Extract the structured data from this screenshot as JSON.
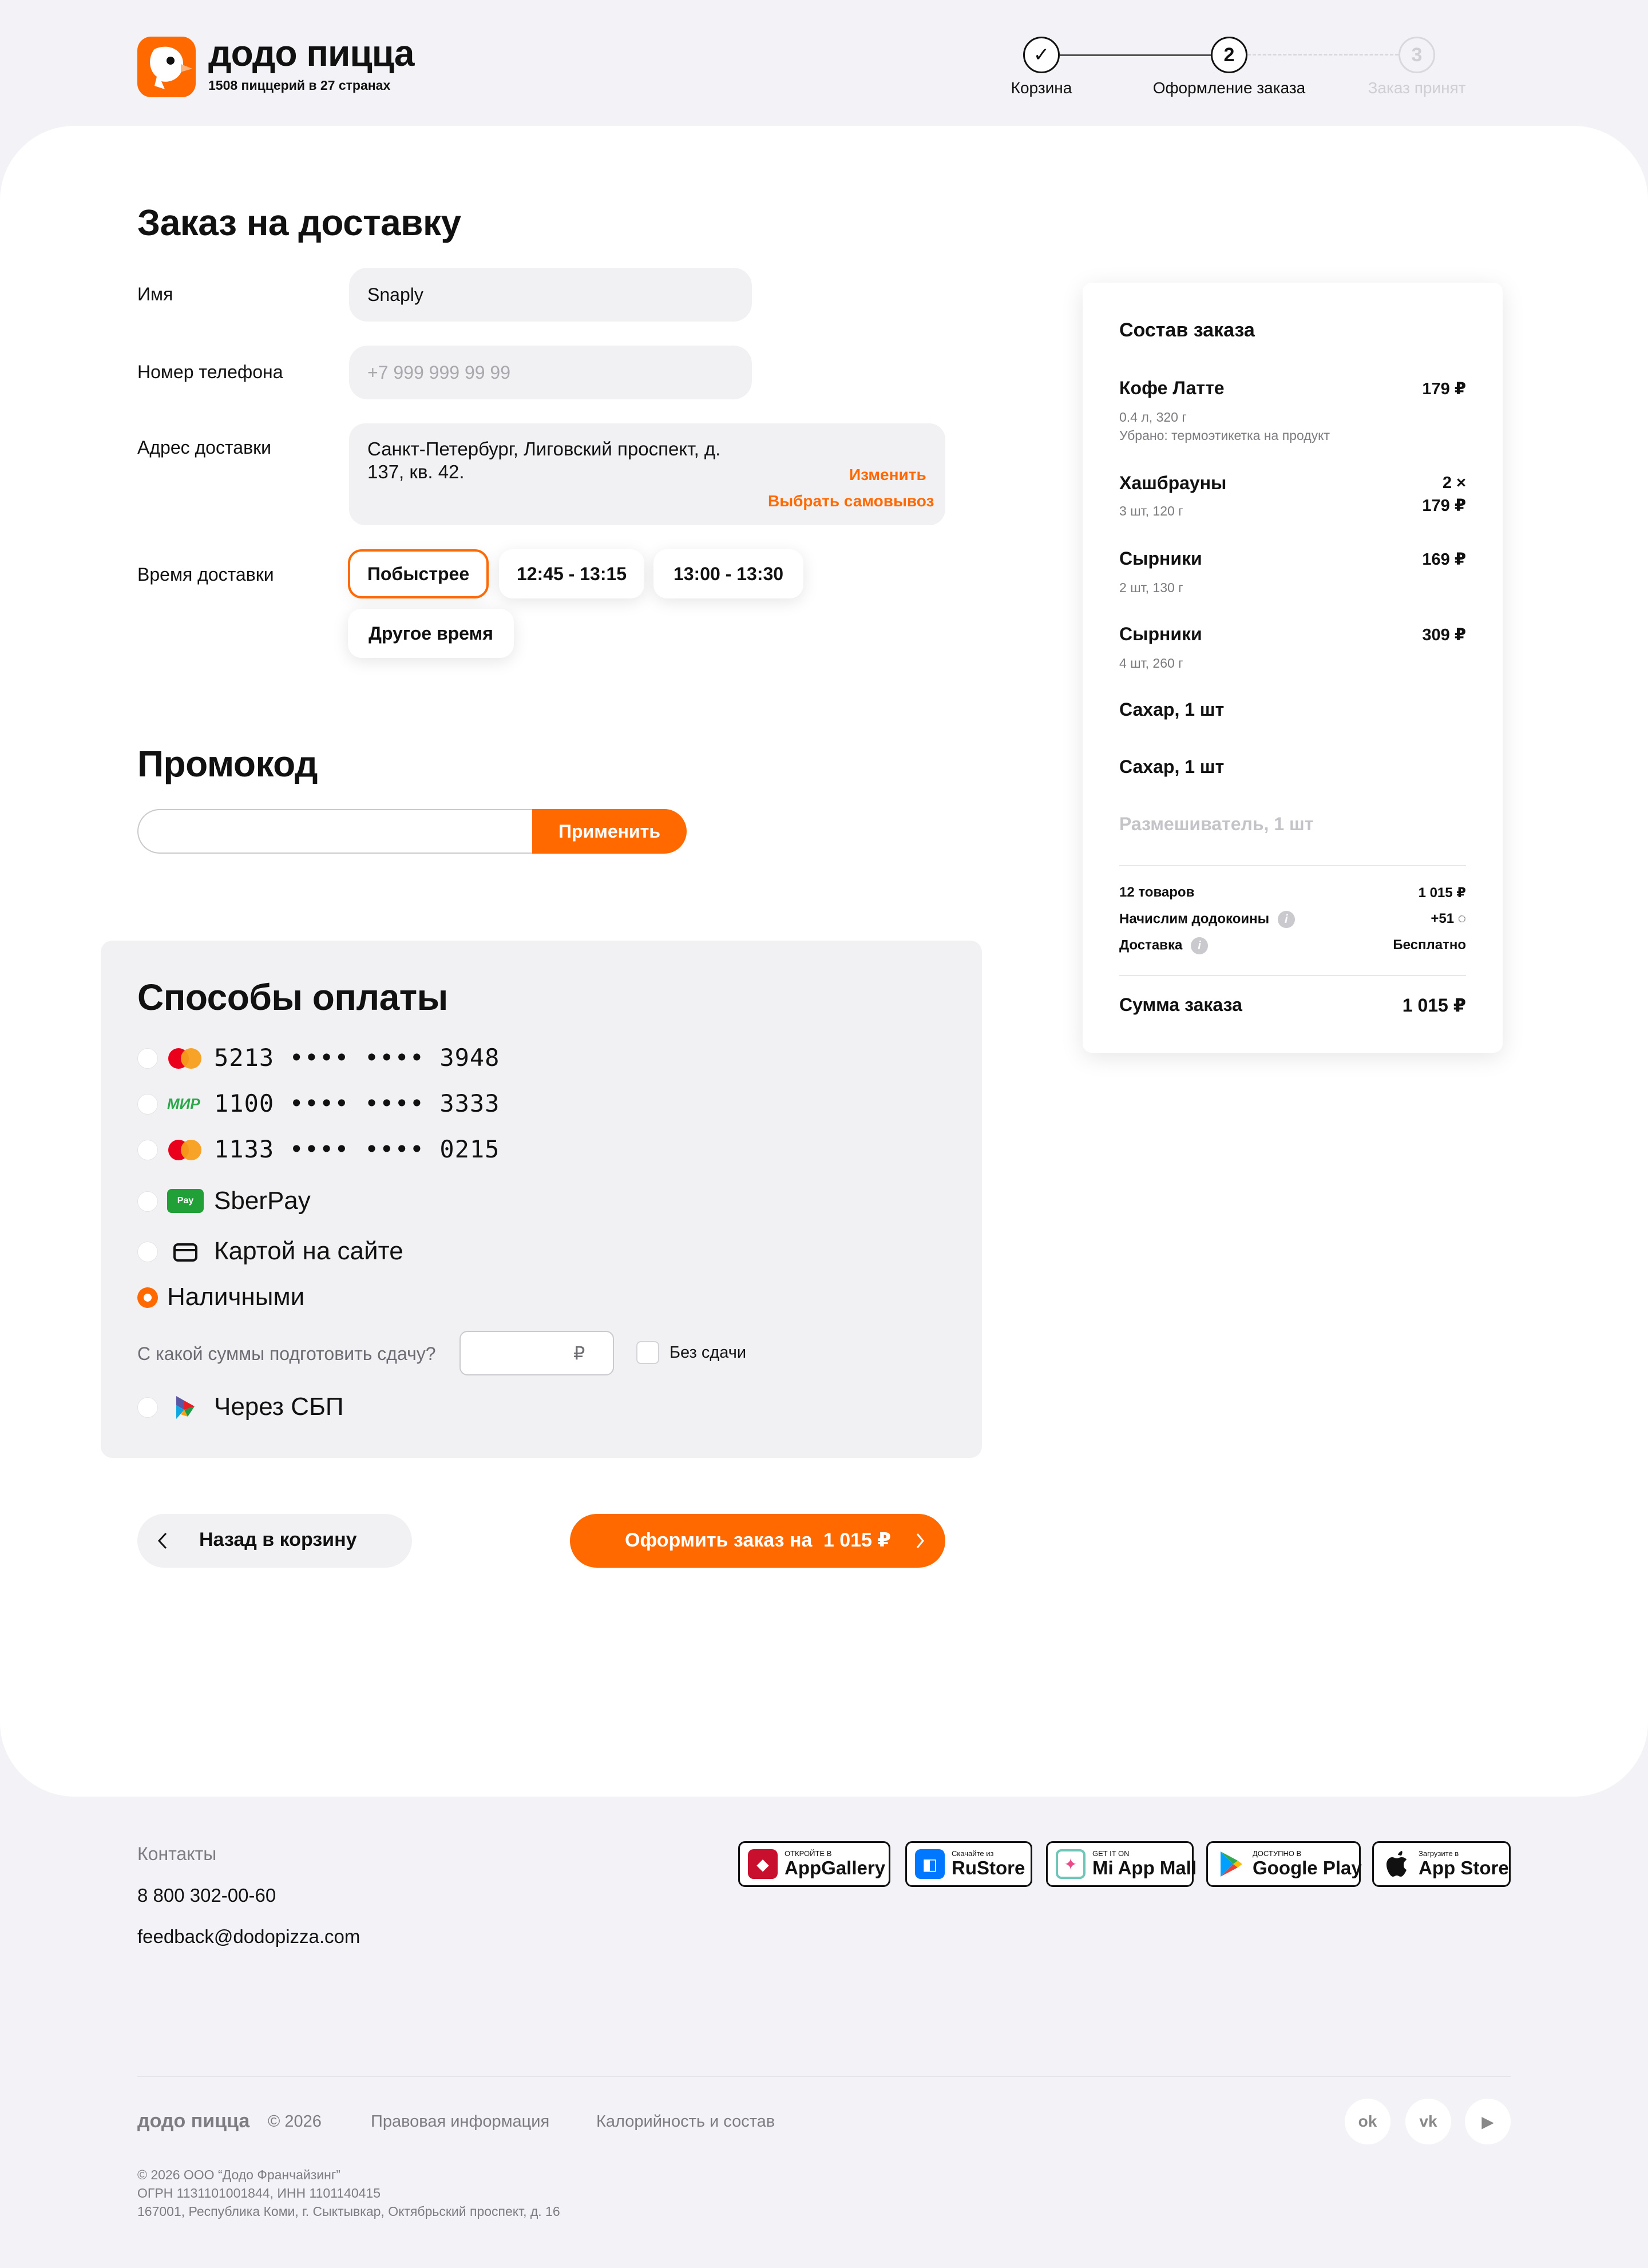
{
  "header": {
    "brand_name": "додо пицца",
    "brand_sub": "1508 пиццерий в 27 странах",
    "steps": [
      {
        "label": "Корзина",
        "marker": "✓"
      },
      {
        "label": "Оформление заказа",
        "marker": "2"
      },
      {
        "label": "Заказ принят",
        "marker": "3"
      }
    ]
  },
  "delivery": {
    "title": "Заказ на доставку",
    "name_label": "Имя",
    "name_value": "Snaply",
    "phone_label": "Номер телефона",
    "phone_placeholder": "+7 999 999 99 99",
    "address_label": "Адрес доставки",
    "address_line1": "Санкт-Петербург, Лиговский проспект, д.",
    "address_line2": "137, кв. 42.",
    "change_link": "Изменить",
    "pickup_link": "Выбрать самовывоз",
    "time_label": "Время доставки",
    "time_options": [
      "Побыстрее",
      "12:45 - 13:15",
      "13:00 - 13:30",
      "Другое время"
    ]
  },
  "promo": {
    "title": "Промокод",
    "input_value": "",
    "apply_label": "Применить"
  },
  "payment": {
    "title": "Способы оплаты",
    "methods": [
      {
        "prefix": "5213",
        "dots": "•••• ••••",
        "suffix": "3948",
        "icon": "mastercard-icon"
      },
      {
        "prefix": "1100",
        "dots": "•••• ••••",
        "suffix": "3333",
        "icon": "mir-icon"
      },
      {
        "prefix": "1133",
        "dots": "•••• ••••",
        "suffix": "0215",
        "icon": "mastercard-icon"
      },
      {
        "label": "SberPay",
        "icon": "sberpay-icon"
      },
      {
        "label": "Картой на сайте",
        "icon": "card-icon"
      },
      {
        "label": "Наличными",
        "selected": true
      },
      {
        "label": "Через СБП",
        "icon": "sbp-icon"
      }
    ],
    "mir_text": "МИР",
    "sberpay_text": "Pay",
    "change_question": "С какой суммы подготовить сдачу?",
    "currency": "₽",
    "no_change_label": "Без сдачи"
  },
  "actions": {
    "back_label": "Назад в корзину",
    "submit_label": "Оформить заказ на",
    "submit_amount": "1 015 ₽"
  },
  "summary": {
    "title": "Состав заказа",
    "items": [
      {
        "name": "Кофе Латте",
        "meta": "0.4 л, 320 г",
        "meta2": "Убрано: термоэтикетка на продукт",
        "price": "179 ₽"
      },
      {
        "name": "Хашбрауны",
        "meta": "3 шт, 120 г",
        "qty": "2 ×",
        "price": "179 ₽"
      },
      {
        "name": "Сырники",
        "meta": "2 шт, 130 г",
        "price": "169 ₽"
      },
      {
        "name": "Сырники",
        "meta": "4 шт, 260 г",
        "price": "309 ₽"
      },
      {
        "name": "Сахар, 1 шт"
      },
      {
        "name": "Сахар, 1 шт"
      },
      {
        "name": "Размешиватель, 1 шт"
      }
    ],
    "count_label": "12 товаров",
    "count_value": "1 015 ₽",
    "coins_label": "Начислим додокоины",
    "coins_value": "+51",
    "delivery_label": "Доставка",
    "delivery_value": "Бесплатно",
    "total_label": "Сумма заказа",
    "total_value": "1 015 ₽"
  },
  "footer": {
    "contacts_title": "Контакты",
    "phone": "8 800 302-00-60",
    "email": "feedback@dodopizza.com",
    "badges": [
      {
        "small": "ОТКРОЙТЕ В",
        "big": "AppGallery",
        "icon": "appgallery-icon",
        "color": "#c8102e"
      },
      {
        "small": "Скачайте из",
        "big": "RuStore",
        "icon": "rustore-icon",
        "color": "#0077ff"
      },
      {
        "small": "GET IT ON",
        "big": "Mi App Mall",
        "icon": "mi-app-mall-icon",
        "color": "#6ec6b8"
      },
      {
        "small": "ДОСТУПНО В",
        "big": "Google Play",
        "icon": "google-play-icon",
        "color": "#34a853"
      },
      {
        "small": "Загрузите в",
        "big": "App Store",
        "icon": "apple-icon",
        "color": "#111111"
      }
    ],
    "brand": "додо пицца",
    "copyright_year": "© 2026",
    "legal_link": "Правовая информация",
    "calories_link": "Калорийность и состав",
    "legal_line1": "© 2026 ООО “Додо Франчайзинг”",
    "legal_line2": "ОГРН 1131101001844, ИНН 1101140415",
    "legal_line3": "167001, Республика Коми, г. Сыктывкар, Октябрьский проспект, д. 16",
    "social": [
      {
        "icon": "odnoklassniki-icon",
        "glyph": "ok"
      },
      {
        "icon": "vk-icon",
        "glyph": "vk"
      },
      {
        "icon": "youtube-icon",
        "glyph": "▶"
      }
    ]
  },
  "colors": {
    "accent": "#ff6900",
    "background": "#f3f3f7",
    "card": "#ffffff"
  }
}
